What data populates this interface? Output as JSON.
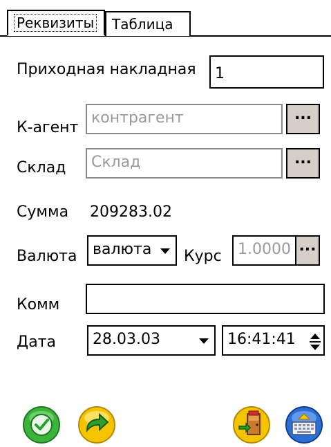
{
  "tabs": [
    {
      "label": "Реквизиты"
    },
    {
      "label": "Таблица"
    }
  ],
  "form": {
    "invoice_label": "Приходная накладная",
    "invoice_value": "1",
    "agent_label": "К-агент",
    "agent_placeholder": "контрагент",
    "store_label": "Склад",
    "store_placeholder": "Склад",
    "sum_label": "Сумма",
    "sum_value": "209283.02",
    "currency_label": "Валюта",
    "currency_value": "валюта",
    "rate_label": "Курс",
    "rate_value": "1.0000",
    "comment_label": "Комм",
    "comment_value": "",
    "date_label": "Дата",
    "date_value": "28.03.03",
    "time_value": "16:41:41",
    "browse_label": "..."
  },
  "icons": {
    "ok": "check-icon",
    "next": "forward-arrow-icon",
    "exit": "exit-door-icon",
    "keyboard": "keyboard-icon"
  },
  "colors": {
    "button_face": "#d6cfc8",
    "disabled_text": "#9a9a9a",
    "ok_green": "#3cb43c",
    "next_yellow": "#f4c400",
    "keyboard_blue": "#2a6fd6"
  }
}
